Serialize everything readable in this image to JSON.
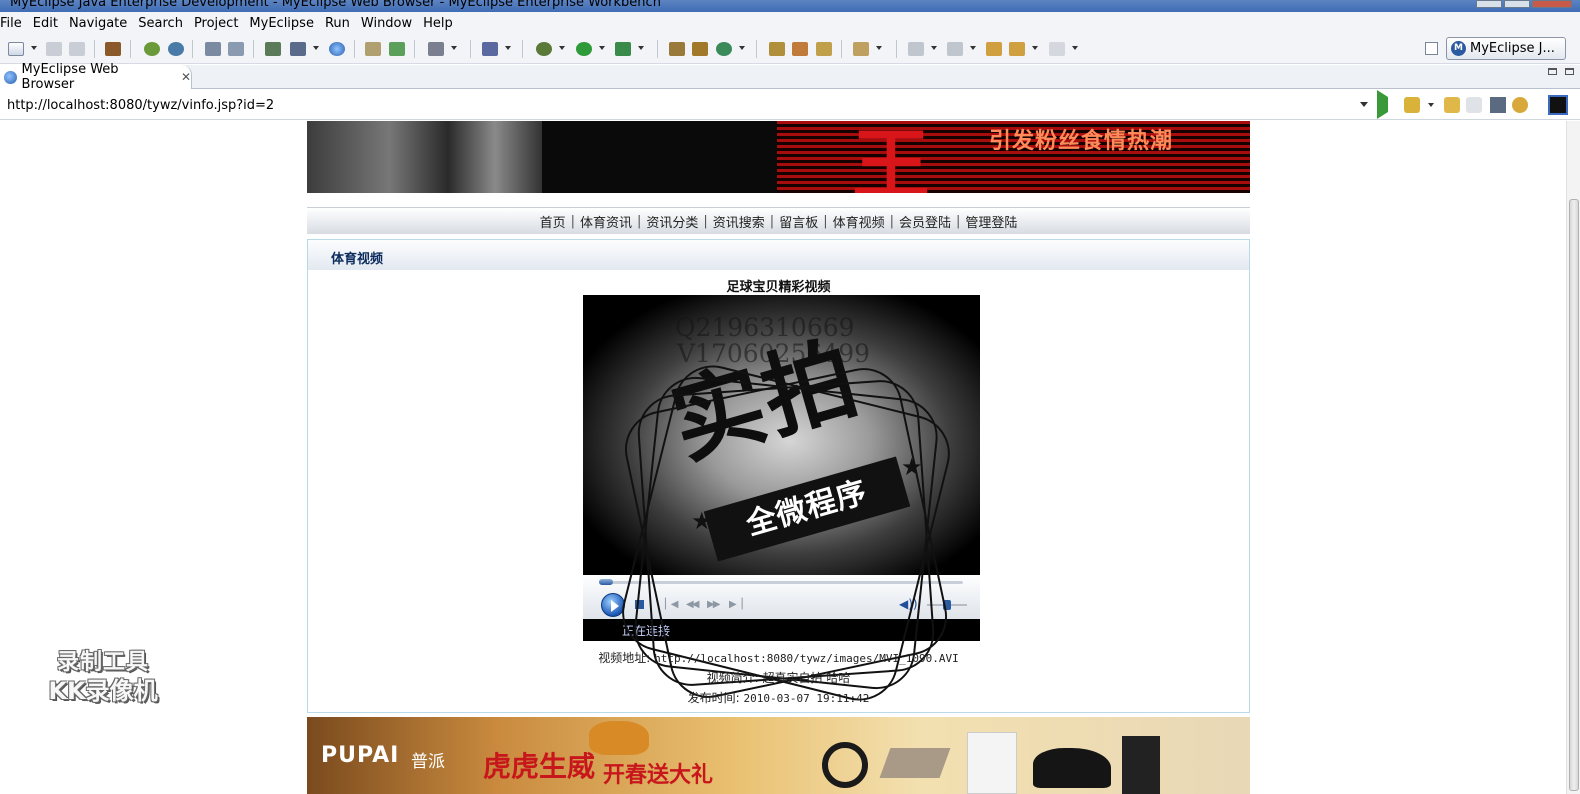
{
  "window": {
    "title": "MyEclipse Java Enterprise Development - MyEclipse Web Browser - MyEclipse Enterprise Workbench"
  },
  "menu": [
    "File",
    "Edit",
    "Navigate",
    "Search",
    "Project",
    "MyEclipse",
    "Run",
    "Window",
    "Help"
  ],
  "perspective": {
    "label": "MyEclipse J..."
  },
  "editor_tab": {
    "label": "MyEclipse Web Browser",
    "close": "✕"
  },
  "browser": {
    "url": "http://localhost:8080/tywz/vinfo.jsp?id=2"
  },
  "page": {
    "banner_top": {
      "slogan": "引发粉丝食情热潮",
      "big_char": "王"
    },
    "nav": [
      "首页",
      "体育资讯",
      "资讯分类",
      "资讯搜索",
      "留言板",
      "体育视频",
      "会员登陆",
      "管理登陆"
    ],
    "nav_separator": "|",
    "section_title": "体育视频",
    "video": {
      "title": "足球宝贝精彩视频",
      "status": "正在连接",
      "address_label": "视频地址:",
      "address": "http://localhost:8080/tywz/images/MVI_1090.AVI",
      "intro_label": "视频简介:",
      "intro": "超真实自拍 哈哈",
      "published_label": "发布时间:",
      "published": "2010-03-07 19:11:42",
      "progress": 0,
      "volume": 0.5
    },
    "watermark": {
      "line1": "Q2196310669",
      "line2": "V17060256499",
      "big": "实拍",
      "ribbon": "全微程序"
    },
    "banner_bottom": {
      "brand": "PUPAI",
      "brand_cn": "普派",
      "promo1": "虎虎生威",
      "promo2": "开春送大礼"
    }
  },
  "recorder_watermark": {
    "line1": "录制工具",
    "line2": "KK录像机"
  },
  "colors": {
    "titlebar": "#3e6cb4",
    "nav_text": "#222222",
    "section_title": "#0b2c5c",
    "panel_border": "#b9dbe9",
    "promo_red": "#c8171c"
  }
}
